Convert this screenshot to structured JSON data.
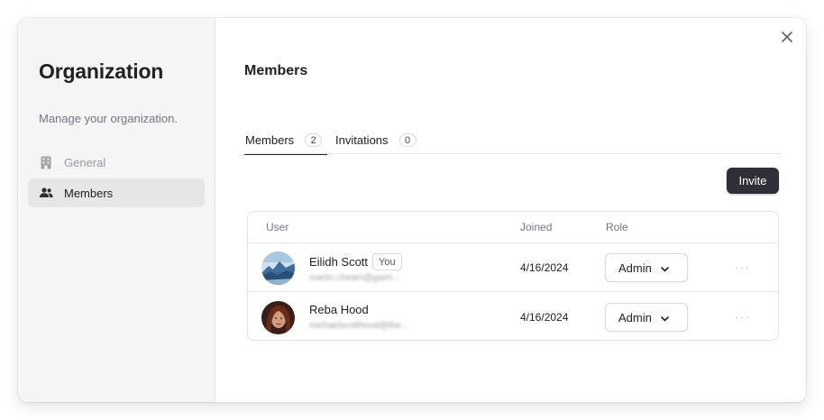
{
  "sidebar": {
    "title": "Organization",
    "description": "Manage your organization.",
    "items": [
      {
        "label": "General",
        "icon": "building-icon"
      },
      {
        "label": "Members",
        "icon": "users-icon",
        "active": true
      }
    ]
  },
  "main": {
    "title": "Members",
    "tabs": [
      {
        "label": "Members",
        "count": "2",
        "active": true
      },
      {
        "label": "Invitations",
        "count": "0"
      }
    ],
    "invite_label": "Invite",
    "table": {
      "headers": {
        "user": "User",
        "joined": "Joined",
        "role": "Role"
      },
      "rows": [
        {
          "name": "Eilidh Scott",
          "badge": "You",
          "email": "martin.cheam@gaim...",
          "joined": "4/16/2024",
          "role": "Admin"
        },
        {
          "name": "Reba Hood",
          "email": "michaelscotthood@the...",
          "joined": "4/16/2024",
          "role": "Admin"
        }
      ]
    }
  },
  "colors": {
    "primary_button": "#2f3037",
    "sidebar_bg": "#f5f5f5",
    "active_item_bg": "#e6e6e6"
  }
}
